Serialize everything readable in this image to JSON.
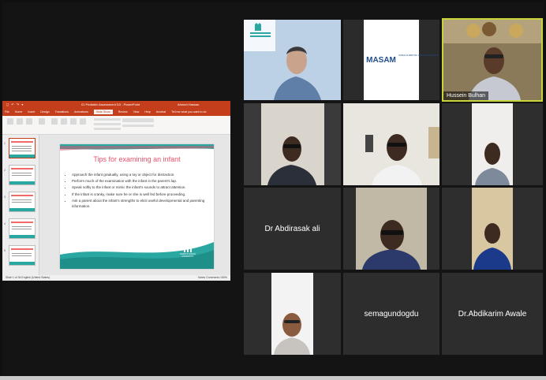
{
  "powerpoint": {
    "window_title": "01 Pediatric Assessment D3 - PowerPoint",
    "user": "Ahmed Hassan",
    "tabs": [
      "File",
      "Home",
      "Insert",
      "Design",
      "Transitions",
      "Animations",
      "Slide Show",
      "Review",
      "View",
      "Help",
      "Acrobat",
      "Tell me what you want to do"
    ],
    "active_tab": "Slide Show",
    "status_left": "Slide 1 of 34   English (United States)",
    "status_right": "Notes   Comments   150%",
    "slide": {
      "title": "Tips for examining an infant",
      "bullets": [
        "Approach the infant gradually, using a toy or object for distraction.",
        "Perform much of the examination with the infant in the parent's lap.",
        "Speak softly to the infant or mimic the infant's sounds to attract attention.",
        "If the infant is cranky, make sure he or she is well fed before proceeding.",
        "Ask a parent about the infant's strengths to elicit useful developmental and parenting information."
      ]
    }
  },
  "participants": {
    "hussein": "Hussein Bulhan",
    "abdirasak": "Dr Abdirasak ali",
    "semagundogdu": "semagundogdu",
    "abdikarim": "Dr.Abdikarim Awale"
  },
  "logos": {
    "masam_text": "MASAM",
    "masam_sub": "SOMALIA MENTAL HEALTH NETWORK",
    "university": "FRANTZ FANON UNIVERSITY"
  },
  "colors": {
    "ppt_accent": "#c43e1c",
    "slide_title": "#e8506a",
    "teal": "#2aa7a1",
    "speaker_border": "#c9d43a"
  }
}
